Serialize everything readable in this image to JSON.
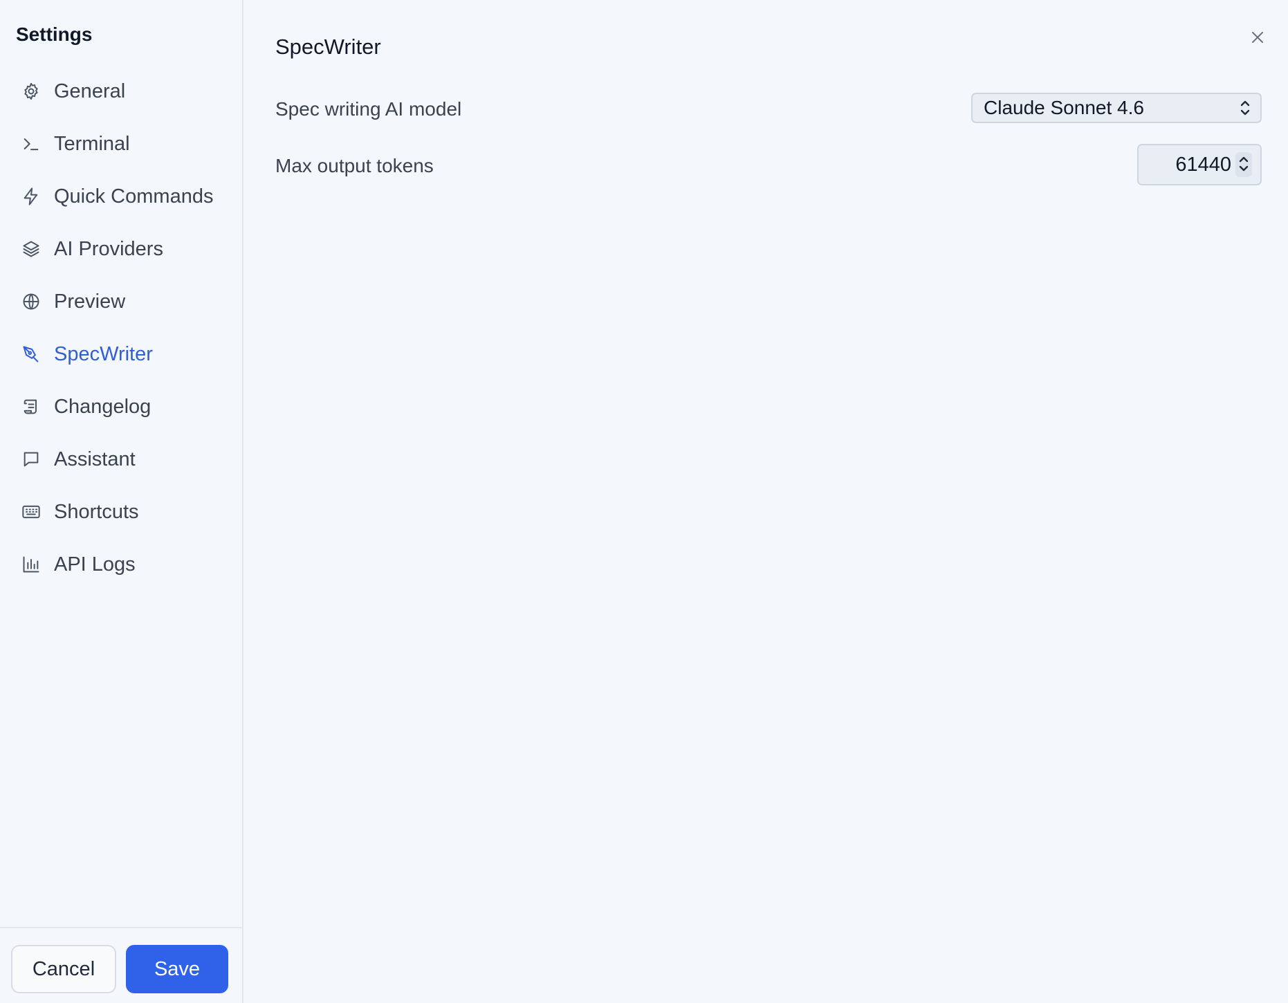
{
  "sidebar": {
    "title": "Settings",
    "items": [
      {
        "label": "General",
        "icon": "gear-icon"
      },
      {
        "label": "Terminal",
        "icon": "terminal-icon"
      },
      {
        "label": "Quick Commands",
        "icon": "lightning-icon"
      },
      {
        "label": "AI Providers",
        "icon": "layers-icon"
      },
      {
        "label": "Preview",
        "icon": "globe-icon"
      },
      {
        "label": "SpecWriter",
        "icon": "pen-nib-icon",
        "active": true
      },
      {
        "label": "Changelog",
        "icon": "scroll-icon"
      },
      {
        "label": "Assistant",
        "icon": "chat-bubble-icon"
      },
      {
        "label": "Shortcuts",
        "icon": "keyboard-icon"
      },
      {
        "label": "API Logs",
        "icon": "bar-chart-icon"
      }
    ],
    "cancel_label": "Cancel",
    "save_label": "Save"
  },
  "main": {
    "title": "SpecWriter",
    "model_label": "Spec writing AI model",
    "model_value": "Claude Sonnet 4.6",
    "tokens_label": "Max output tokens",
    "tokens_value": "61440"
  },
  "colors": {
    "accent": "#2f5fd6",
    "save_button": "#2f62e9",
    "background": "#f4f7fb"
  }
}
